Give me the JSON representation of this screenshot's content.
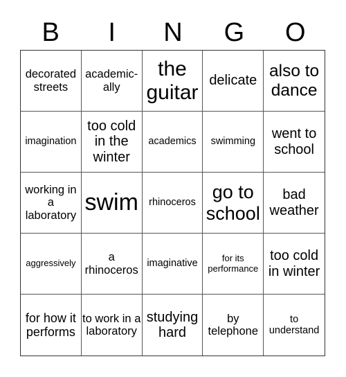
{
  "header": [
    "B",
    "I",
    "N",
    "G",
    "O"
  ],
  "cells": [
    "decorated streets",
    "academic-ally",
    "the guitar",
    "delicate",
    "also to dance",
    "imagination",
    "too cold in the winter",
    "academics",
    "swimming",
    "went to school",
    "working in a laboratory",
    "swim",
    "rhinoceros",
    "go to school",
    "bad weather",
    "aggressively",
    "a rhinoceros",
    "imaginative",
    "for its performance",
    "too cold in winter",
    "for how it performs",
    "to work in a laboratory",
    "studying hard",
    "by telephone",
    "to understand"
  ]
}
